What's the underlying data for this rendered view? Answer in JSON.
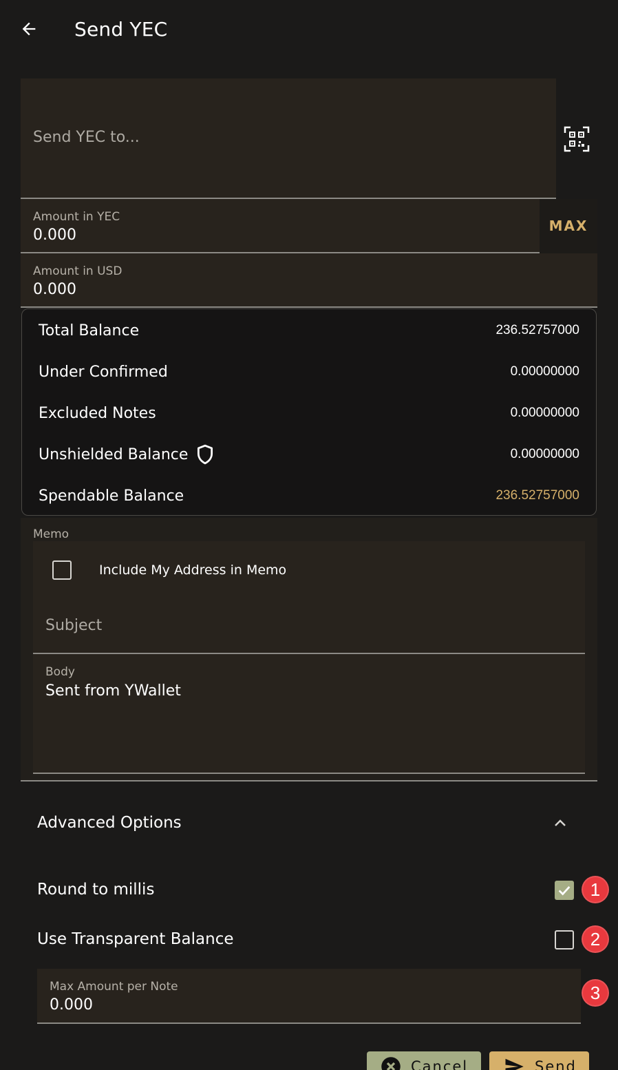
{
  "header": {
    "title": "Send YEC",
    "back_icon": "arrow-left-icon"
  },
  "address": {
    "placeholder": "Send YEC to...",
    "scan_icon": "qr-scan-icon"
  },
  "amount_yec": {
    "label": "Amount in YEC",
    "value": "0.000",
    "max_label": "MAX"
  },
  "amount_usd": {
    "label": "Amount in USD",
    "value": "0.000"
  },
  "balances": [
    {
      "label": "Total Balance",
      "value": "236.52757000"
    },
    {
      "label": "Under Confirmed",
      "value": "0.00000000"
    },
    {
      "label": "Excluded Notes",
      "value": "0.00000000"
    },
    {
      "label": "Unshielded Balance",
      "value": "0.00000000",
      "icon": "shield-icon"
    },
    {
      "label": "Spendable Balance",
      "value": "236.52757000",
      "color": "#d6b06a"
    }
  ],
  "memo": {
    "label": "Memo",
    "include_address_label": "Include My Address in Memo",
    "include_address_checked": false,
    "subject_placeholder": "Subject",
    "body_label": "Body",
    "body_value": "Sent from YWallet"
  },
  "advanced": {
    "title": "Advanced Options",
    "toggle_icon": "chevron-up-icon",
    "round_to_millis_label": "Round to millis",
    "round_to_millis_checked": true,
    "use_transparent_label": "Use Transparent Balance",
    "use_transparent_checked": false,
    "max_amount_label": "Max Amount per Note",
    "max_amount_value": "0.000",
    "badges": [
      "1",
      "2",
      "3"
    ]
  },
  "actions": {
    "cancel_label": "Cancel",
    "send_label": "Send"
  },
  "colors": {
    "background": "#1b1a19",
    "field": "#28231d",
    "accent_gold": "#d6b06a",
    "accent_green": "#a5ad85",
    "badge_red": "#e8393e"
  }
}
